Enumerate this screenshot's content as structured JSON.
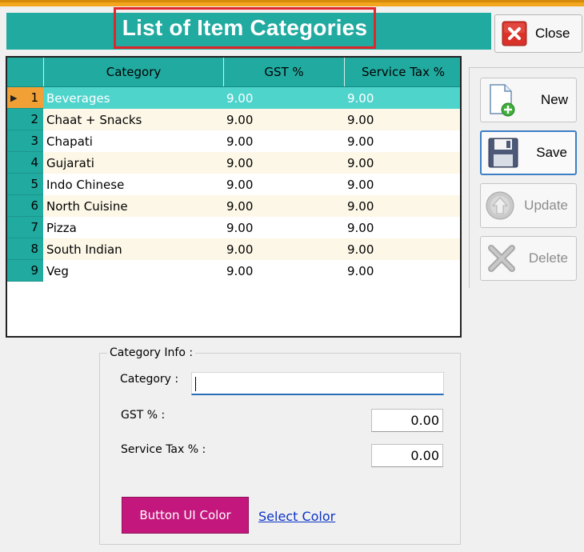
{
  "title": "List of Item Categories",
  "close_label": "Close",
  "grid": {
    "headers": {
      "category": "Category",
      "gst": "GST %",
      "service_tax": "Service Tax %"
    },
    "rows": [
      {
        "num": "1",
        "category": "Beverages",
        "gst": "9.00",
        "service_tax": "9.00"
      },
      {
        "num": "2",
        "category": "Chaat + Snacks",
        "gst": "9.00",
        "service_tax": "9.00"
      },
      {
        "num": "3",
        "category": "Chapati",
        "gst": "9.00",
        "service_tax": "9.00"
      },
      {
        "num": "4",
        "category": "Gujarati",
        "gst": "9.00",
        "service_tax": "9.00"
      },
      {
        "num": "5",
        "category": "Indo Chinese",
        "gst": "9.00",
        "service_tax": "9.00"
      },
      {
        "num": "6",
        "category": "North Cuisine",
        "gst": "9.00",
        "service_tax": "9.00"
      },
      {
        "num": "7",
        "category": "Pizza",
        "gst": "9.00",
        "service_tax": "9.00"
      },
      {
        "num": "8",
        "category": "South Indian",
        "gst": "9.00",
        "service_tax": "9.00"
      },
      {
        "num": "9",
        "category": "Veg",
        "gst": "9.00",
        "service_tax": "9.00"
      }
    ],
    "selected_row": "1"
  },
  "actions": {
    "new": "New",
    "save": "Save",
    "update": "Update",
    "delete": "Delete"
  },
  "form": {
    "legend": "Category Info :",
    "category_label": "Category :",
    "category_value": "",
    "gst_label": "GST % :",
    "gst_value": "0.00",
    "service_tax_label": "Service Tax % :",
    "service_tax_value": "0.00",
    "button_ui_color_label": "Button UI Color",
    "select_color_label": "Select Color"
  },
  "colors": {
    "header_teal": "#21aaa0",
    "selected_row": "#4fd4cc",
    "button_ui_color": "#c4177d",
    "title_border": "#e0262b"
  }
}
